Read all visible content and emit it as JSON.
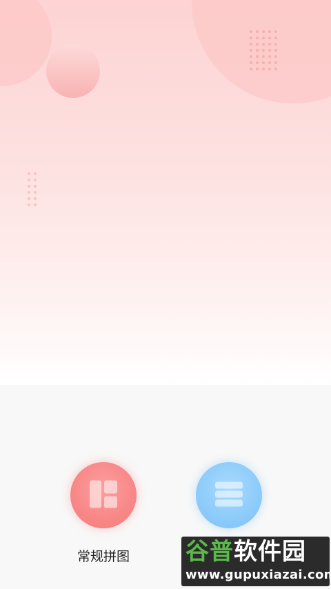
{
  "home": {
    "actions": [
      {
        "label": "常规拼图",
        "icon": "grid-layout-icon",
        "color": "#f88787"
      },
      {
        "label": "",
        "icon": "list-stack-icon",
        "color": "#8ccbfa"
      }
    ]
  },
  "watermark": {
    "title_part1": "谷普",
    "title_part2": "软件园",
    "url": "www.gupuxiazai.com"
  }
}
